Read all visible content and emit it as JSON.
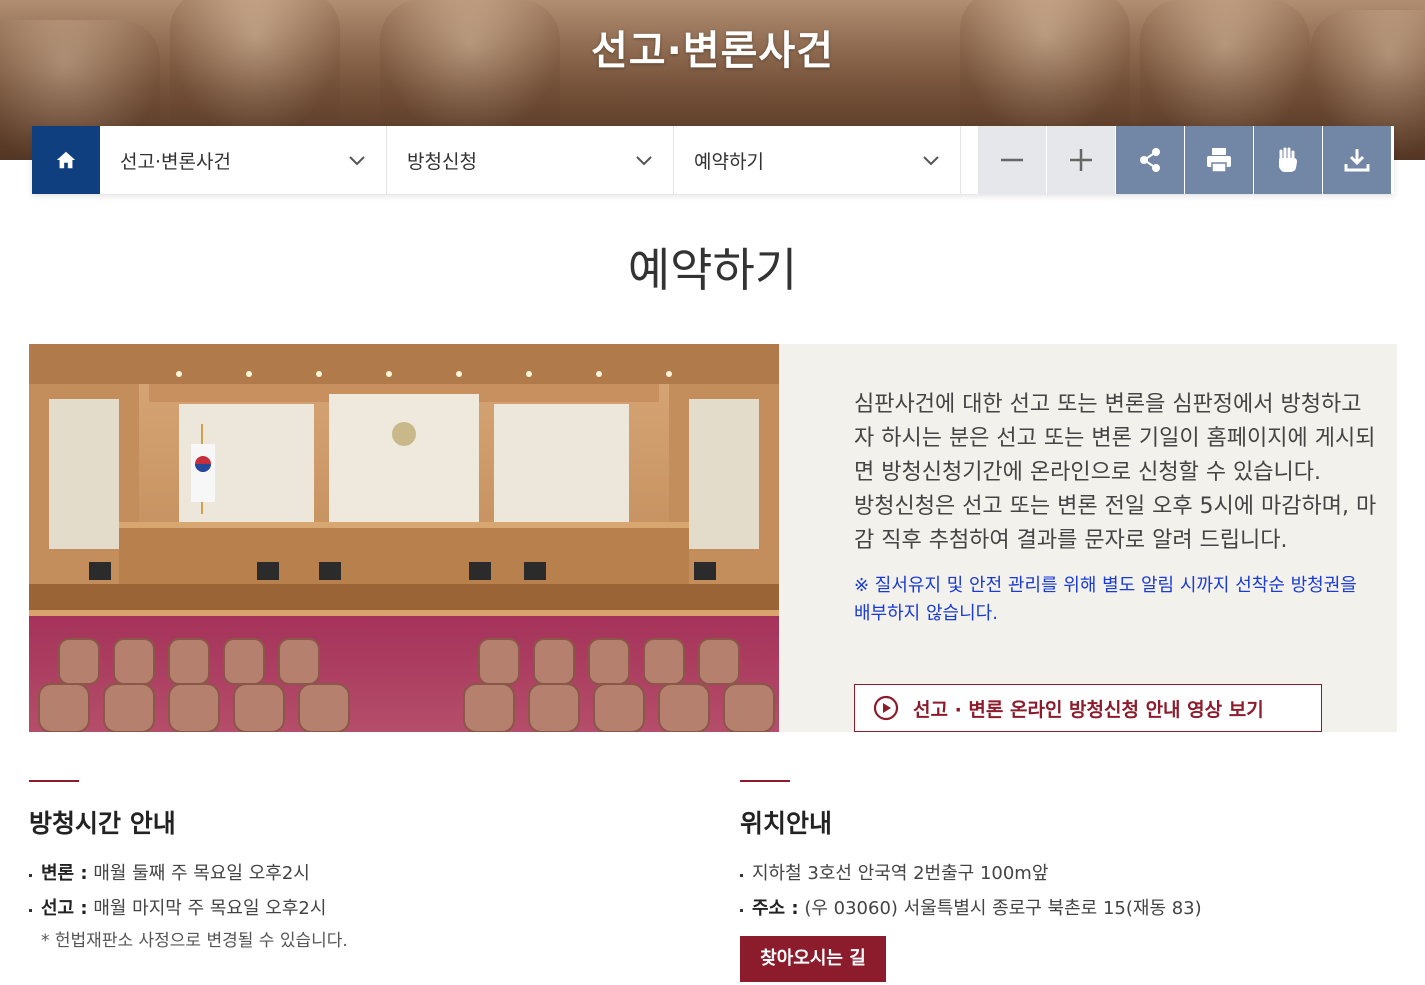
{
  "hero": {
    "title": "선고·변론사건"
  },
  "nav": {
    "home_icon": "home-icon",
    "menus": [
      {
        "label": "선고·변론사건"
      },
      {
        "label": "방청신청"
      },
      {
        "label": "예약하기"
      }
    ],
    "tools": [
      "zoom-out-icon",
      "zoom-in-icon",
      "share-icon",
      "print-icon",
      "hand-icon",
      "download-icon"
    ],
    "colors": {
      "home_bg": "#0f3f7e",
      "tool_bg": "#7286a6",
      "zoom_bg": "#e5e7ea"
    }
  },
  "page": {
    "title": "예약하기"
  },
  "intro": {
    "description": "심판사건에 대한 선고 또는 변론을 심판정에서 방청하고자 하시는 분은 선고 또는 변론 기일이 홈페이지에 게시되면 방청신청기간에 온라인으로 신청할 수 있습니다.",
    "description2": "방청신청은 선고 또는 변론 전일 오후 5시에 마감하며, 마감 직후 추첨하여 결과를 문자로 알려 드립니다.",
    "notice": "※ 질서유지 및 안전 관리를 위해 별도 알림 시까지 선착순 방청권을 배부하지 않습니다.",
    "video_button": "선고 · 변론 온라인 방청신청 안내 영상 보기"
  },
  "hours": {
    "title": "방청시간 안내",
    "items": [
      {
        "label": "변론 :",
        "value": "매월 둘째 주 목요일 오후2시"
      },
      {
        "label": "선고 :",
        "value": "매월 마지막 주 목요일 오후2시"
      }
    ],
    "note": "* 헌법재판소 사정으로 변경될 수 있습니다."
  },
  "location": {
    "title": "위치안내",
    "subway": "지하철 3호선 안국역 2번출구 100m앞",
    "address_label": "주소 :",
    "address": "(우 03060) 서울특별시 종로구 북촌로 15(재동 83)",
    "route_button": "찾아오시는 길"
  },
  "accent_color": "#8c1c2c"
}
